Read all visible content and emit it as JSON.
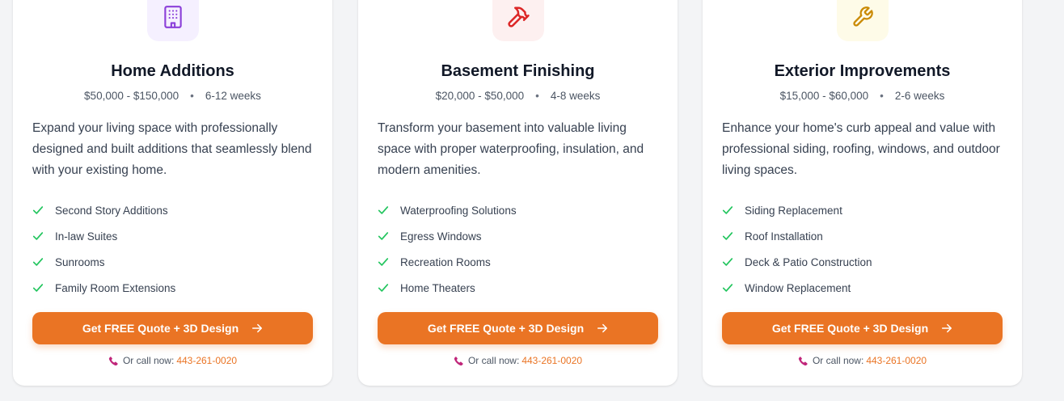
{
  "colors": {
    "accent": "#ea7424",
    "check": "#22c55e",
    "phone_icon": "#c0267a"
  },
  "cards": [
    {
      "icon": "building-icon",
      "icon_color": "#8b3fd9",
      "icon_bg": "#f5f0ff",
      "title": "Home Additions",
      "price": "$50,000 - $150,000",
      "sep": "•",
      "duration": "6-12 weeks",
      "description": "Expand your living space with professionally designed and built additions that seamlessly blend with your existing home.",
      "features": [
        "Second Story Additions",
        "In-law Suites",
        "Sunrooms",
        "Family Room Extensions"
      ],
      "cta": "Get FREE Quote + 3D Design",
      "call_label": "Or call now:",
      "phone": "443-261-0020"
    },
    {
      "icon": "hammer-icon",
      "icon_color": "#dc2626",
      "icon_bg": "#fdf0f0",
      "title": "Basement Finishing",
      "price": "$20,000 - $50,000",
      "sep": "•",
      "duration": "4-8 weeks",
      "description": "Transform your basement into valuable living space with proper waterproofing, insulation, and modern amenities.",
      "features": [
        "Waterproofing Solutions",
        "Egress Windows",
        "Recreation Rooms",
        "Home Theaters"
      ],
      "cta": "Get FREE Quote + 3D Design",
      "call_label": "Or call now:",
      "phone": "443-261-0020"
    },
    {
      "icon": "wrench-icon",
      "icon_color": "#ca8a04",
      "icon_bg": "#fefbe8",
      "title": "Exterior Improvements",
      "price": "$15,000 - $60,000",
      "sep": "•",
      "duration": "2-6 weeks",
      "description": "Enhance your home's curb appeal and value with professional siding, roofing, windows, and outdoor living spaces.",
      "features": [
        "Siding Replacement",
        "Roof Installation",
        "Deck & Patio Construction",
        "Window Replacement"
      ],
      "cta": "Get FREE Quote + 3D Design",
      "call_label": "Or call now:",
      "phone": "443-261-0020"
    }
  ]
}
